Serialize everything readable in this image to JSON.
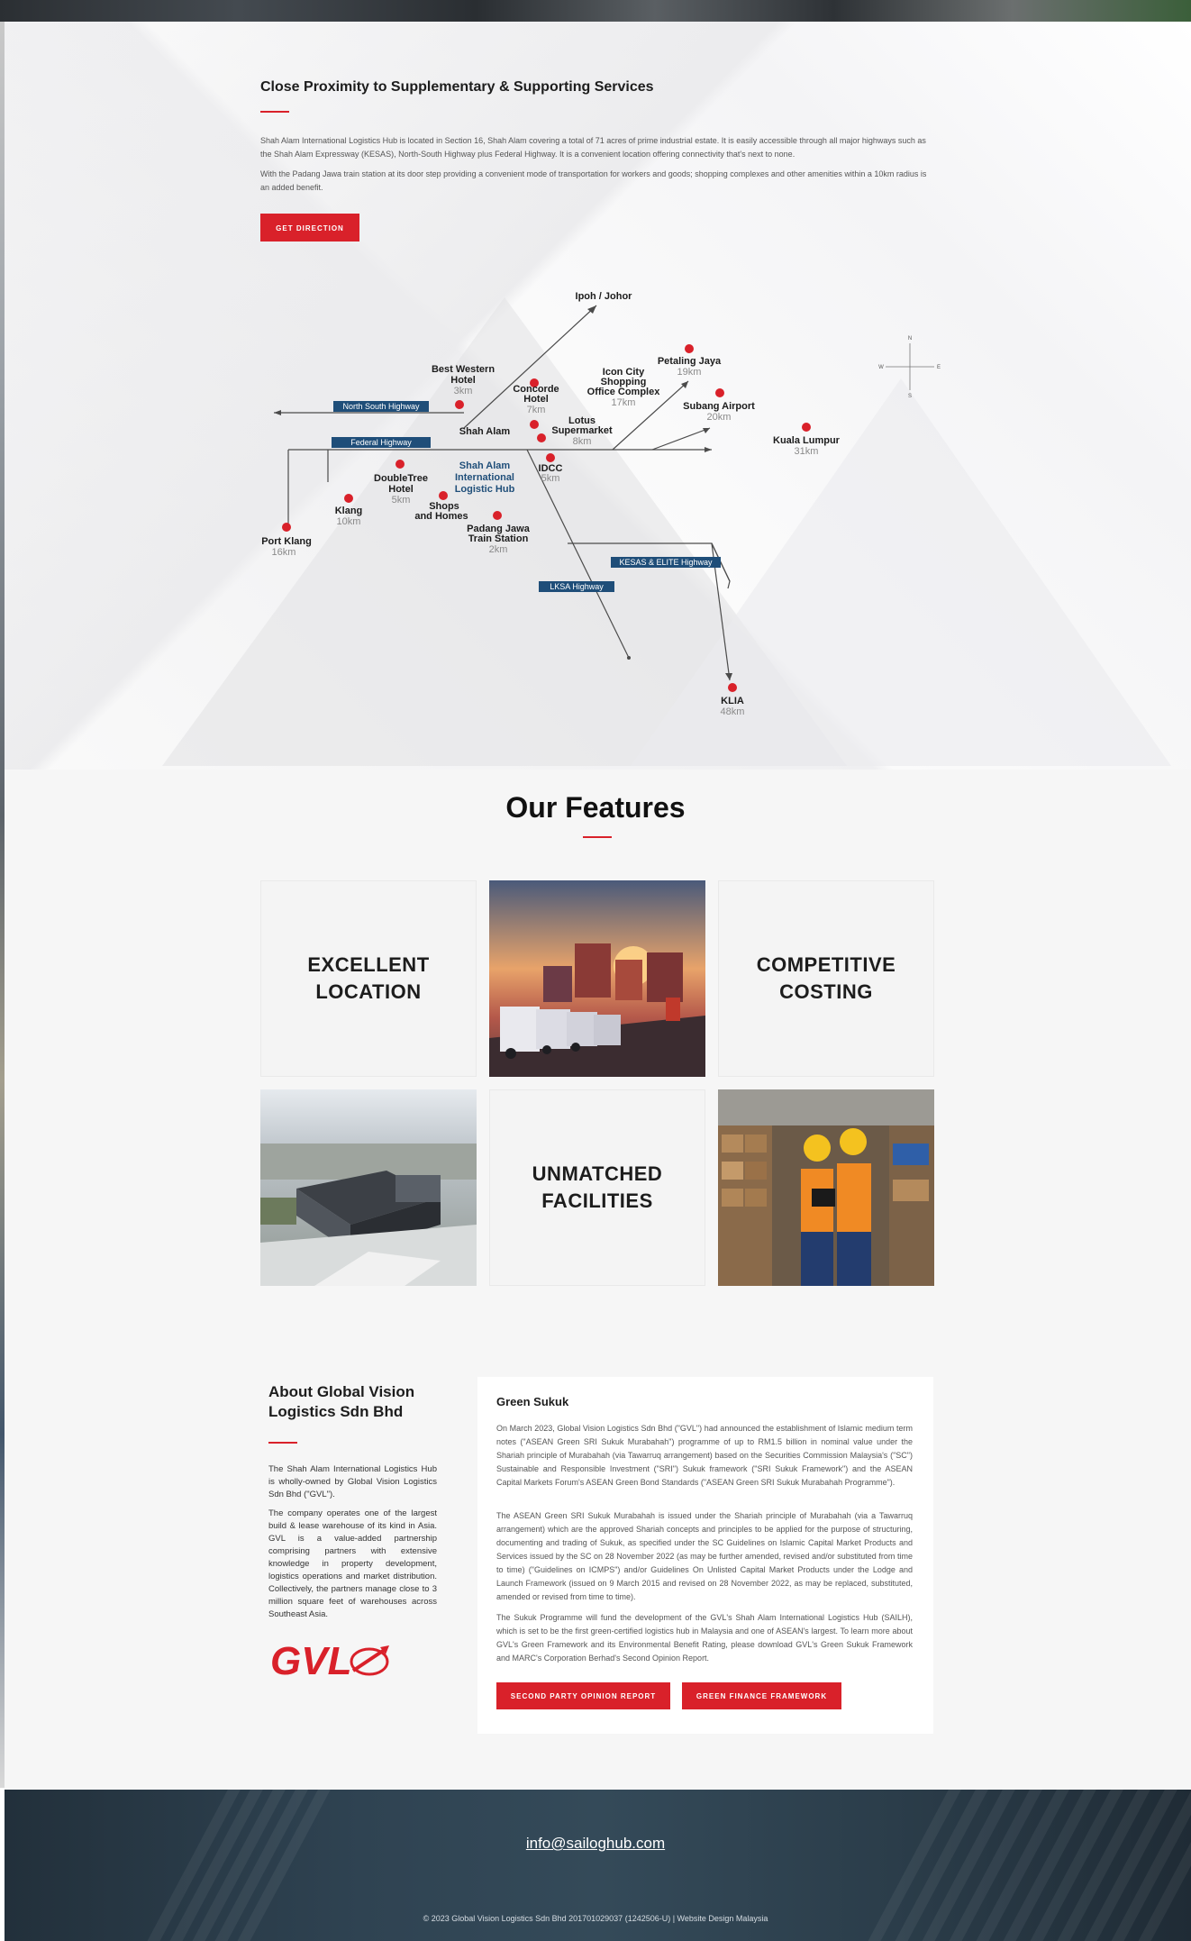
{
  "proximity": {
    "title": "Close Proximity to Supplementary & Supporting Services",
    "paragraph_1": "Shah Alam International Logistics Hub is located in Section 16, Shah Alam covering a total of 71 acres of prime industrial estate. It is easily accessible through all major highways such as the Shah Alam Expressway (KESAS), North-South Highway plus Federal Highway. It is a convenient location offering connectivity that's next to none.",
    "paragraph_2": "With the Padang Jawa train station at its door step providing a convenient mode of transportation for workers and goods; shopping complexes and other amenities within a 10km radius is an added benefit.",
    "button_label": "GET DIRECTION"
  },
  "map": {
    "destination_top": "Ipoh / Johor",
    "highways": {
      "north_south": "North South Highway",
      "federal": "Federal Highway",
      "kesas_elite": "KESAS & ELITE Highway",
      "lksa": "LKSA Highway"
    },
    "places": {
      "best_western": {
        "name_1": "Best Western",
        "name_2": "Hotel",
        "dist": "3km"
      },
      "concorde": {
        "name_1": "Concorde",
        "name_2": "Hotel",
        "dist": "7km"
      },
      "icon_city": {
        "name_1": "Icon City",
        "name_2": "Shopping",
        "name_3": "Office Complex",
        "dist": "17km"
      },
      "petaling_jaya": {
        "name": "Petaling Jaya",
        "dist": "19km"
      },
      "subang_airport": {
        "name": "Subang Airport",
        "dist": "20km"
      },
      "kuala_lumpur": {
        "name": "Kuala Lumpur",
        "dist": "31km"
      },
      "shah_alam": {
        "name": "Shah Alam"
      },
      "lotus": {
        "name_1": "Lotus",
        "name_2": "Supermarket",
        "dist": "8km"
      },
      "idcc": {
        "name": "IDCC",
        "dist": "5km"
      },
      "hub": {
        "name_1": "Shah Alam",
        "name_2": "International",
        "name_3": "Logistic Hub"
      },
      "doubletree": {
        "name_1": "DoubleTree",
        "name_2": "Hotel",
        "dist": "5km"
      },
      "klang": {
        "name": "Klang",
        "dist": "10km"
      },
      "shops": {
        "name_1": "Shops",
        "name_2": "and Homes"
      },
      "padang_jawa": {
        "name_1": "Padang Jawa",
        "name_2": "Train Station",
        "dist": "2km"
      },
      "port_klang": {
        "name": "Port Klang",
        "dist": "16km"
      },
      "klia": {
        "name": "KLIA",
        "dist": "48km"
      }
    },
    "compass": {
      "n": "N",
      "s": "S",
      "e": "E",
      "w": "W"
    },
    "colors": {
      "accent": "#d9212a",
      "highway_label": "#1f4e79"
    }
  },
  "features": {
    "title": "Our Features",
    "cards": {
      "location": "EXCELLENT\nLOCATION",
      "costing": "COMPETITIVE\nCOSTING",
      "facilities": "UNMATCHED\nFACILITIES"
    }
  },
  "about": {
    "title": "About Global Vision Logistics Sdn Bhd",
    "paragraph_1": "The Shah Alam International Logistics Hub is wholly-owned by Global Vision Logistics Sdn Bhd (\"GVL\").",
    "paragraph_2": "The company operates one of the largest build & lease warehouse of its kind in Asia. GVL is a value-added partnership comprising partners with extensive knowledge in property development, logistics operations and market distribution. Collectively, the partners manage close to 3 million square feet of warehouses across Southeast Asia.",
    "logo_text": "GVL"
  },
  "sukuk": {
    "title": "Green Sukuk",
    "paragraph_1": "On March 2023, Global Vision Logistics Sdn Bhd (\"GVL\") had announced the establishment of Islamic medium term notes (\"ASEAN Green SRI Sukuk Murabahah\") programme of up to RM1.5 billion in nominal value under the Shariah principle of Murabahah (via Tawarruq arrangement) based on the Securities Commission Malaysia's (\"SC\") Sustainable and Responsible Investment (\"SRI\") Sukuk framework (\"SRI Sukuk Framework\") and the ASEAN Capital Markets Forum's ASEAN Green Bond Standards (\"ASEAN Green SRI Sukuk Murabahah Programme\").",
    "paragraph_2": "The ASEAN Green SRI Sukuk Murabahah is issued under the Shariah principle of Murabahah (via a Tawarruq arrangement) which are the approved Shariah concepts and principles to be applied for the purpose of structuring, documenting and trading of Sukuk, as specified under the SC Guidelines on Islamic Capital Market Products and Services issued by the SC on 28 November 2022 (as may be further amended, revised and/or substituted from time to time) (\"Guidelines on ICMPS\") and/or Guidelines On Unlisted Capital Market Products under the Lodge and Launch Framework (issued on 9 March 2015 and revised on 28 November 2022, as may be replaced, substituted, amended or revised from time to time).",
    "paragraph_3": "The Sukuk Programme will fund the development of the GVL's Shah Alam International Logistics Hub (SAILH), which is set to be the first green-certified logistics hub in Malaysia and one of ASEAN's largest. To learn more about GVL's Green Framework and its Environmental Benefit Rating, please download GVL's Green Sukuk Framework and MARC's Corporation Berhad's Second Opinion Report.",
    "button_1": "SECOND PARTY OPINION REPORT",
    "button_2": "GREEN FINANCE FRAMEWORK"
  },
  "footer": {
    "email": "info@sailoghub.com",
    "copyright": "© 2023 Global Vision Logistics Sdn Bhd 201701029037 (1242506-U) | Website Design Malaysia"
  }
}
